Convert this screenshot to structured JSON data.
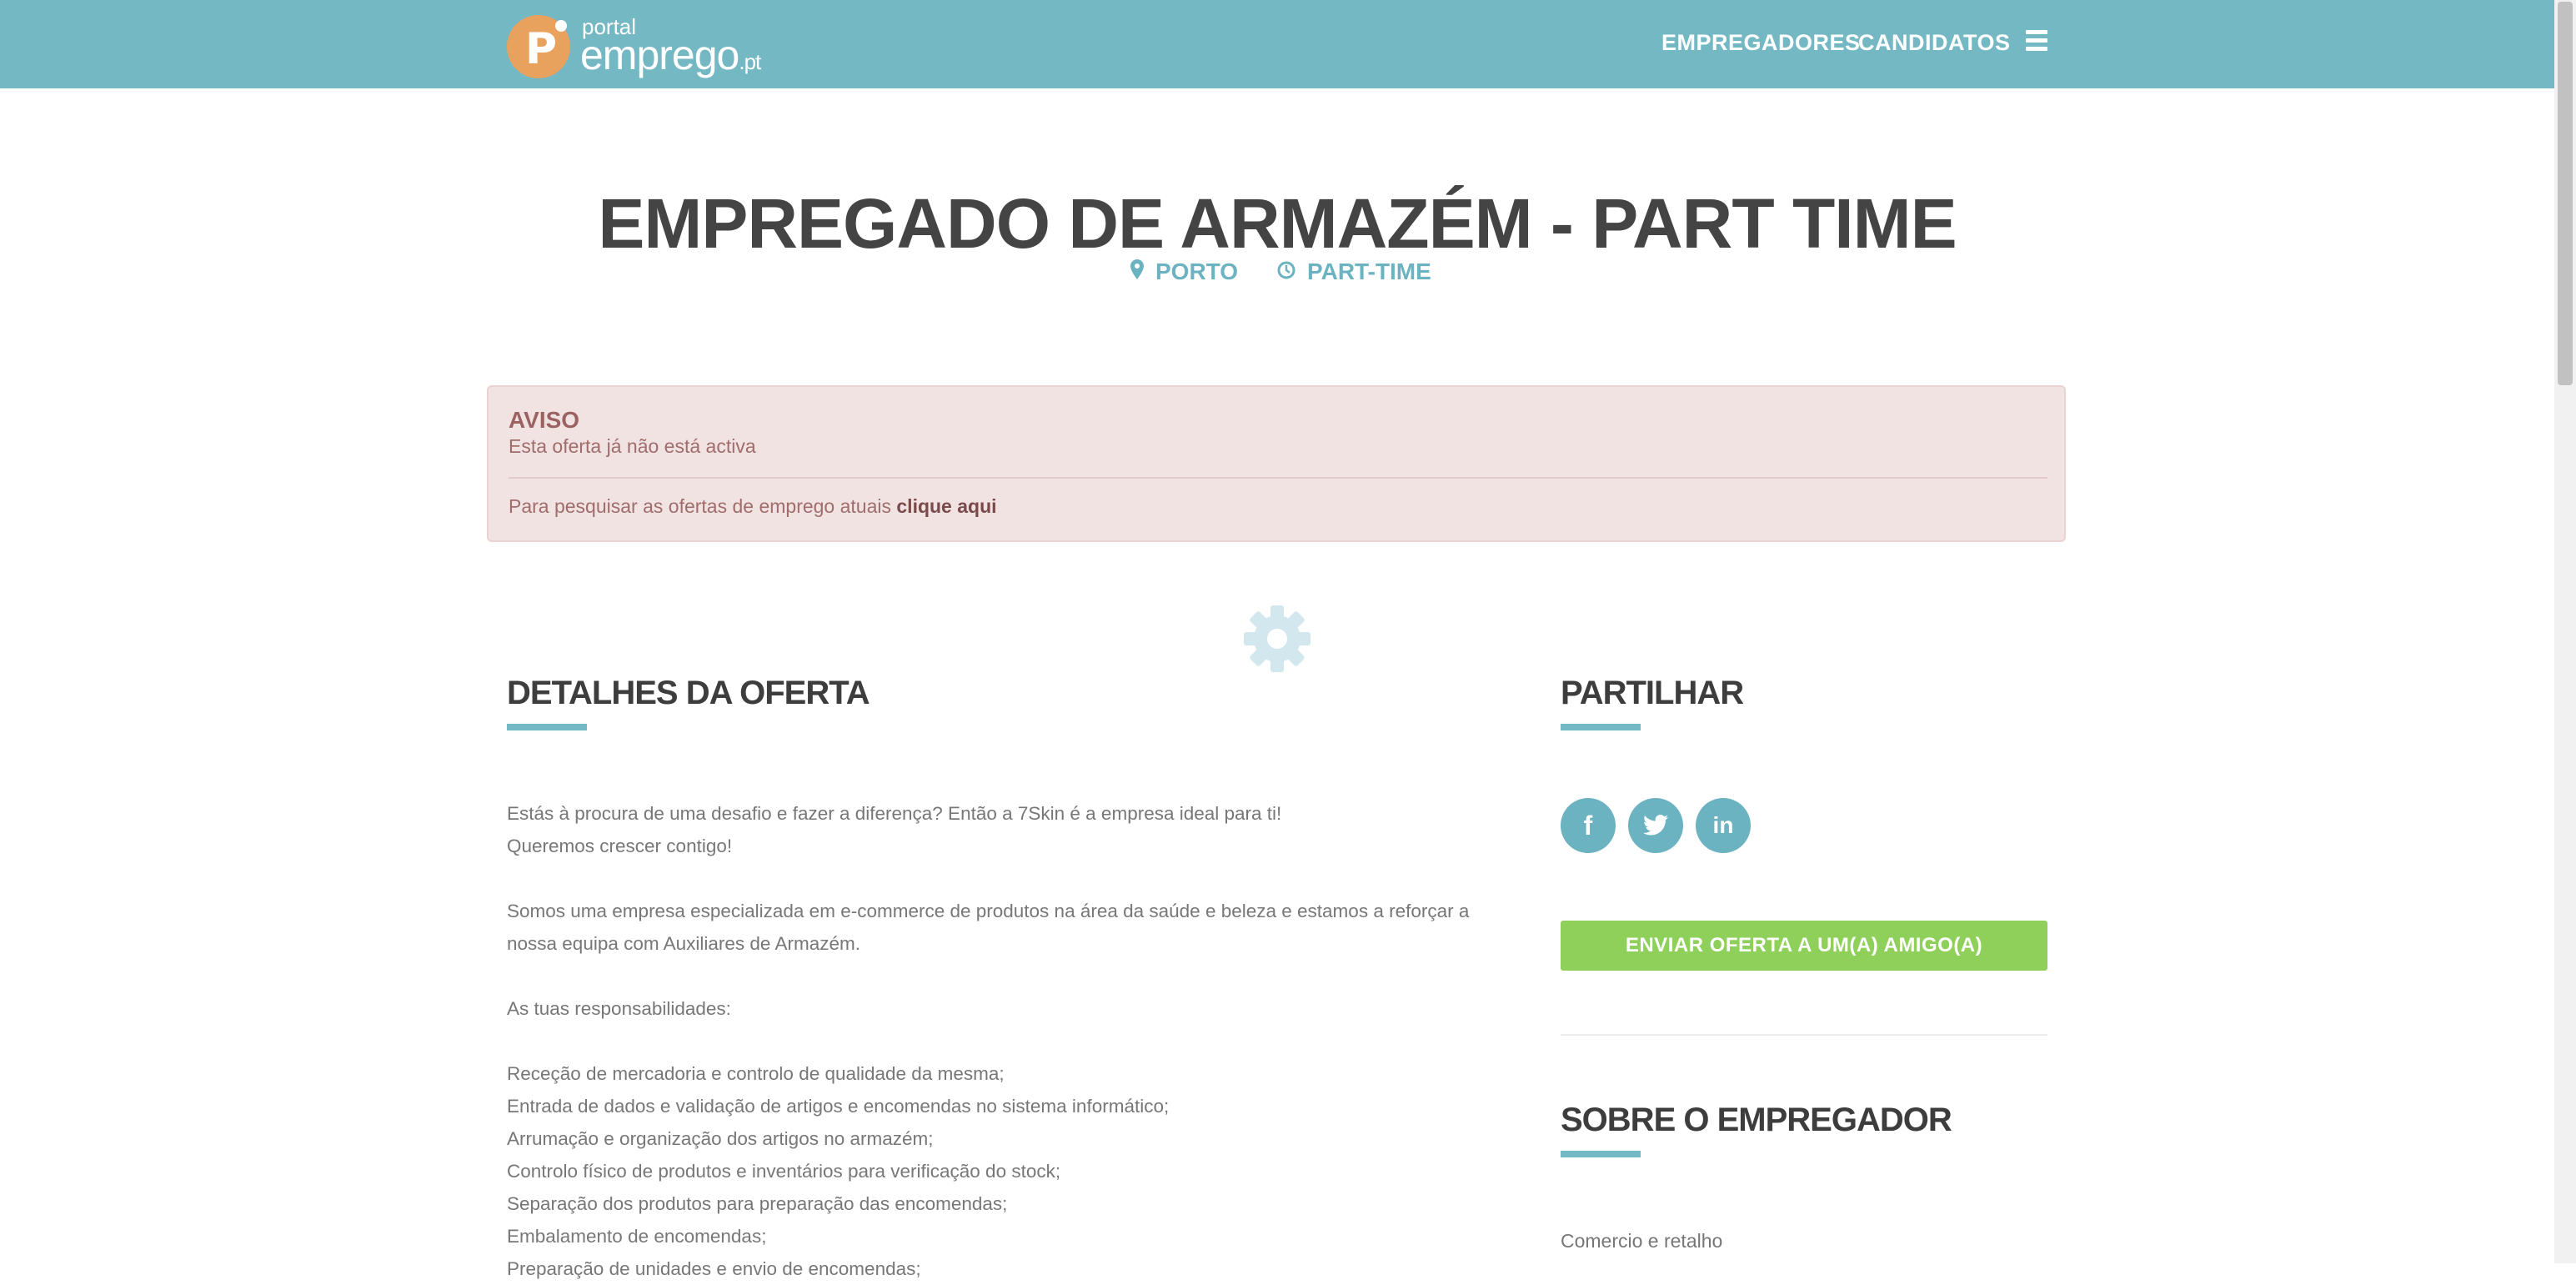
{
  "header": {
    "logo": {
      "small": "portal",
      "big": "emprego",
      "suffix": ".pt",
      "icon": "p-logo-icon"
    },
    "nav": {
      "employers": "EMPREGADORES",
      "candidates": "CANDIDATOS",
      "menu_icon": "hamburger-icon"
    },
    "background_color": "#74b8c4"
  },
  "job": {
    "title": "EMPREGADO DE ARMAZÉM - PART TIME",
    "location": "PORTO",
    "type": "PART-TIME",
    "location_icon": "map-marker-icon",
    "type_icon": "clock-icon"
  },
  "alert": {
    "title": "AVISO",
    "text": "Esta oferta já não está activa",
    "search_prefix": "Para pesquisar as ofertas de emprego atuais",
    "search_link": "clique aqui"
  },
  "loader": {
    "icon": "gear-icon"
  },
  "details": {
    "heading": "DETALHES DA OFERTA",
    "paragraphs": [
      "Estás à procura de uma desafio e fazer a diferença? Então a 7Skin é a empresa ideal para ti!",
      "Queremos crescer contigo!",
      "",
      "Somos uma empresa especializada em e-commerce de produtos na área da saúde e beleza e estamos a reforçar a nossa equipa com Auxiliares de Armazém.",
      "",
      "As tuas responsabilidades:",
      "",
      "Receção de mercadoria e controlo de qualidade da mesma;",
      "Entrada de dados e validação de artigos e encomendas no sistema informático;",
      "Arrumação e organização dos artigos no armazém;",
      "Controlo físico de produtos e inventários para verificação do stock;",
      "Separação dos produtos para preparação das encomendas;",
      "Embalamento de encomendas;",
      "Preparação de unidades e envio de encomendas;"
    ]
  },
  "share": {
    "heading": "PARTILHAR",
    "facebook": "f",
    "facebook_icon": "facebook-icon",
    "twitter_icon": "twitter-icon",
    "linkedin": "in",
    "linkedin_icon": "linkedin-icon",
    "send_button": "ENVIAR OFERTA A UM(A) AMIGO(A)"
  },
  "employer": {
    "heading": "SOBRE O EMPREGADOR",
    "sector": "Comercio e retalho"
  },
  "colors": {
    "accent": "#74b8c4",
    "button": "#8fd05a",
    "alert_bg": "#f2e3e3",
    "logo": "#e8a25e"
  }
}
